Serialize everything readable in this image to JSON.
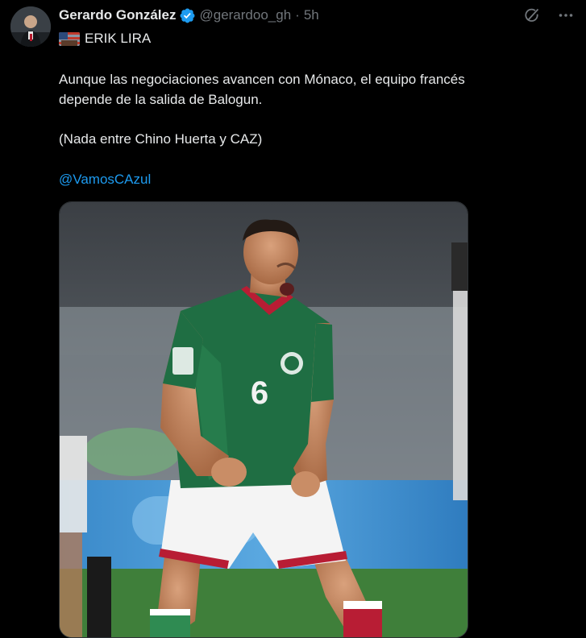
{
  "author": {
    "name": "Gerardo González",
    "handle": "@gerardoo_gh",
    "time": "5h"
  },
  "tweet": {
    "title_text": "ERIK LIRA",
    "body_line1": "Aunque las negociaciones avancen con Mónaco, el equipo francés",
    "body_line2": "depende de la salida de Balogun.",
    "body_line3": "(Nada entre Chino Huerta y CAZ)",
    "mention": "@VamosCAzul",
    "separator": "·"
  },
  "jersey": {
    "number": "6"
  },
  "icons": {
    "verified": "verified-badge-icon",
    "grok": "grok-icon",
    "more": "more-options-icon",
    "flag": "flag-icon"
  },
  "colors": {
    "background": "#000000",
    "text": "#e7e9ea",
    "muted": "#71767b",
    "link": "#1d9bf0",
    "jersey_green": "#1f6e43"
  }
}
